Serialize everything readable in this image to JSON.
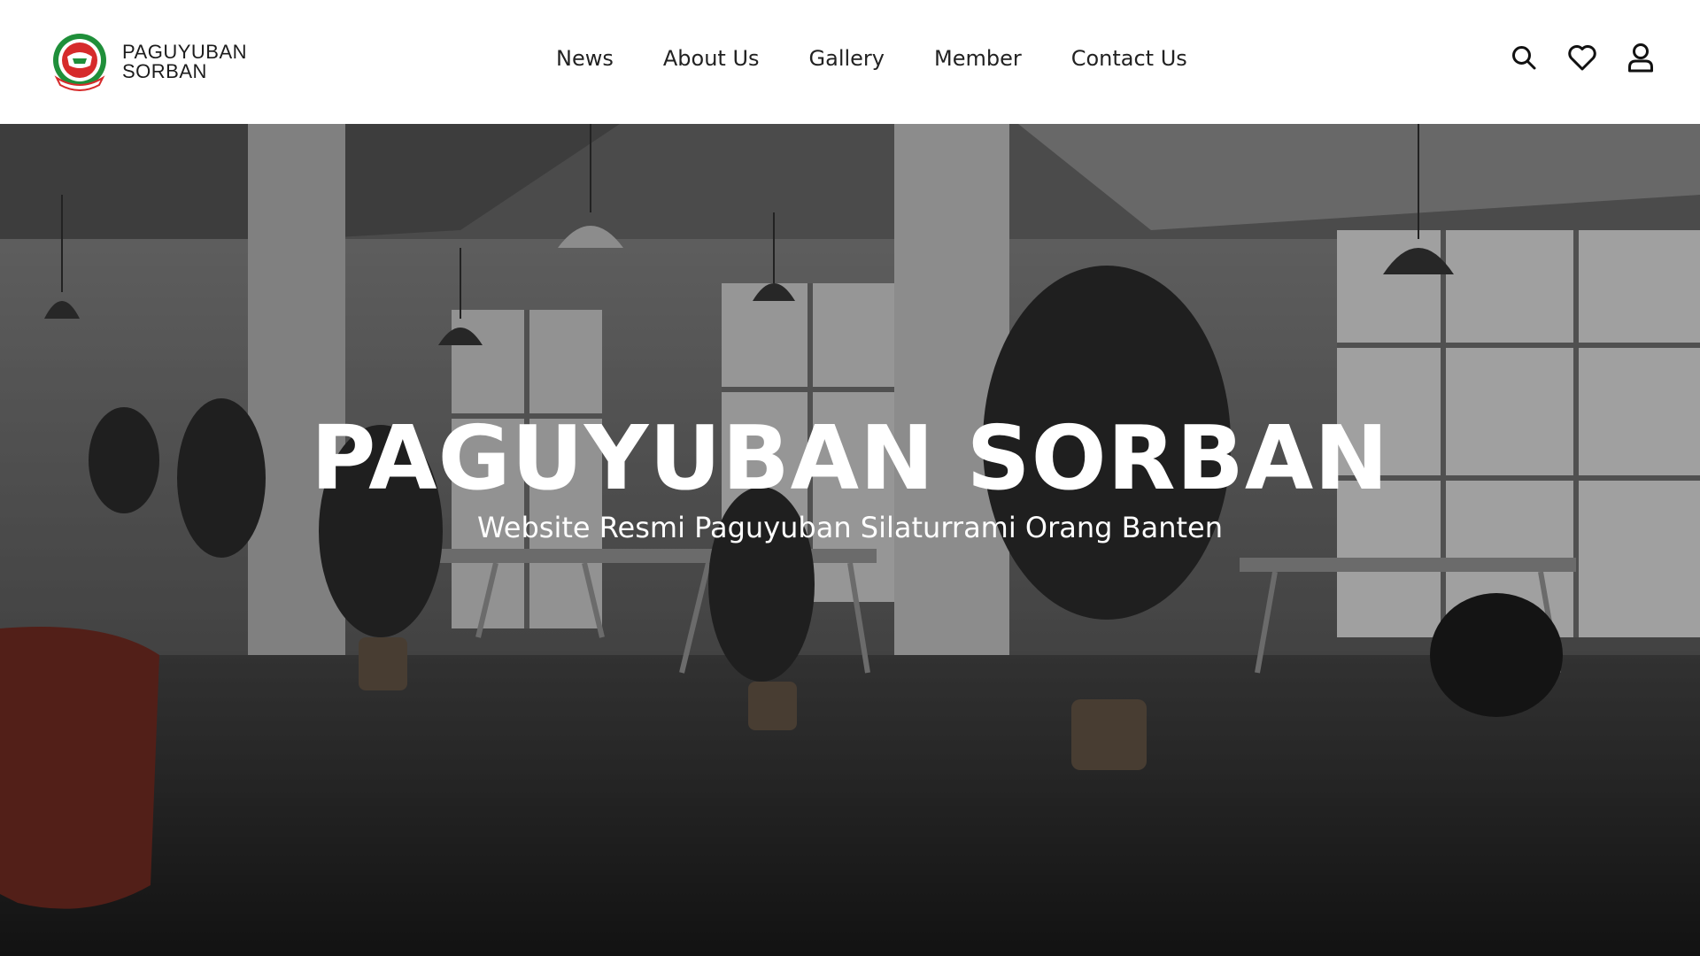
{
  "brand": {
    "name_line1": "PAGUYUBAN",
    "name_line2": "SORBAN",
    "logo_icon": "paguyuban-sorban-emblem"
  },
  "nav": {
    "items": [
      {
        "label": "News"
      },
      {
        "label": "About Us"
      },
      {
        "label": "Gallery"
      },
      {
        "label": "Member"
      },
      {
        "label": "Contact Us"
      }
    ]
  },
  "header_actions": {
    "icons": [
      "search-icon",
      "heart-icon",
      "user-icon"
    ]
  },
  "hero": {
    "title": "PAGUYUBAN SORBAN",
    "subtitle": "Website Resmi Paguyuban Silaturrami Orang Banten"
  },
  "colors": {
    "header_bg": "#ffffff",
    "text_dark": "#222222",
    "hero_text": "#ffffff",
    "logo_green": "#1f8f3a",
    "logo_red": "#d62b2b"
  }
}
